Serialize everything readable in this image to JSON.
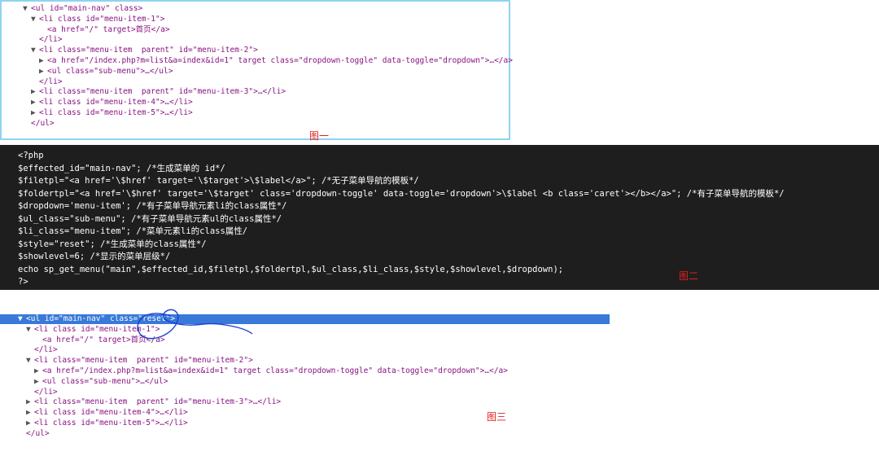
{
  "panel1": {
    "lines": [
      {
        "indent": 0,
        "tri": "▼",
        "html": "<ul id=\"main-nav\" class>"
      },
      {
        "indent": 1,
        "tri": "▼",
        "html": "<li class id=\"menu-item-1\">"
      },
      {
        "indent": 2,
        "tri": "",
        "html": "<a href=\"/\" target>首页</a>"
      },
      {
        "indent": 1,
        "tri": "",
        "html": "</li>"
      },
      {
        "indent": 1,
        "tri": "▼",
        "html": "<li class=\"menu-item  parent\" id=\"menu-item-2\">"
      },
      {
        "indent": 2,
        "tri": "▶",
        "html": "<a href=\"/index.php?m=list&a=index&id=1\" target class=\"dropdown-toggle\" data-toggle=\"dropdown\">…</a>"
      },
      {
        "indent": 2,
        "tri": "▶",
        "html": "<ul class=\"sub-menu\">…</ul>"
      },
      {
        "indent": 1,
        "tri": "",
        "html": "</li>"
      },
      {
        "indent": 1,
        "tri": "▶",
        "html": "<li class=\"menu-item  parent\" id=\"menu-item-3\">…</li>"
      },
      {
        "indent": 1,
        "tri": "▶",
        "html": "<li class id=\"menu-item-4\">…</li>"
      },
      {
        "indent": 1,
        "tri": "▶",
        "html": "<li class id=\"menu-item-5\">…</li>"
      },
      {
        "indent": 0,
        "tri": "",
        "html": "</ul>"
      }
    ],
    "caption": "图一"
  },
  "panel2": {
    "lines": [
      "<?php",
      "$effected_id=\"main-nav\"; /*生成菜单的 id*/",
      "$filetpl=\"<a href='\\$href' target='\\$target'>\\$label</a>\"; /*无子菜单导航的模板*/",
      "$foldertpl=\"<a href='\\$href' target='\\$target' class='dropdown-toggle' data-toggle='dropdown'>\\$label <b class='caret'></b></a>\"; /*有子菜单导航的模板*/",
      "$dropdown='menu-item'; /*有子菜单导航元素li的class属性*/",
      "$ul_class=\"sub-menu\"; /*有子菜单导航元素ul的class属性*/",
      "$li_class=\"menu-item\"; /*菜单元素li的class属性/",
      "$style=\"reset\"; /*生成菜单的class属性*/",
      "$showlevel=6; /*显示的菜单层级*/",
      "echo sp_get_menu(\"main\",$effected_id,$filetpl,$foldertpl,$ul_class,$li_class,$style,$showlevel,$dropdown);",
      "?>"
    ],
    "caption": "图二"
  },
  "panel3": {
    "lines": [
      {
        "indent": 0,
        "tri": "▼",
        "html": "<ul id=\"main-nav\" class=\"reset\">"
      },
      {
        "indent": 1,
        "tri": "▼",
        "html": "<li class id=\"menu-item-1\">"
      },
      {
        "indent": 2,
        "tri": "",
        "html": "<a href=\"/\" target>首页</a>"
      },
      {
        "indent": 1,
        "tri": "",
        "html": "</li>"
      },
      {
        "indent": 1,
        "tri": "▼",
        "html": "<li class=\"menu-item  parent\" id=\"menu-item-2\">"
      },
      {
        "indent": 2,
        "tri": "▶",
        "html": "<a href=\"/index.php?m=list&a=index&id=1\" target class=\"dropdown-toggle\" data-toggle=\"dropdown\">…</a>"
      },
      {
        "indent": 2,
        "tri": "▶",
        "html": "<ul class=\"sub-menu\">…</ul>"
      },
      {
        "indent": 1,
        "tri": "",
        "html": "</li>"
      },
      {
        "indent": 1,
        "tri": "▶",
        "html": "<li class=\"menu-item  parent\" id=\"menu-item-3\">…</li>"
      },
      {
        "indent": 1,
        "tri": "▶",
        "html": "<li class id=\"menu-item-4\">…</li>"
      },
      {
        "indent": 1,
        "tri": "▶",
        "html": "<li class id=\"menu-item-5\">…</li>"
      },
      {
        "indent": 0,
        "tri": "",
        "html": "</ul>"
      }
    ],
    "caption": "图三"
  },
  "colors": {
    "selection": "#3879d9",
    "caption": "#e02020",
    "code_bg": "#1e1e1e",
    "frame": "#8fd3f1"
  }
}
